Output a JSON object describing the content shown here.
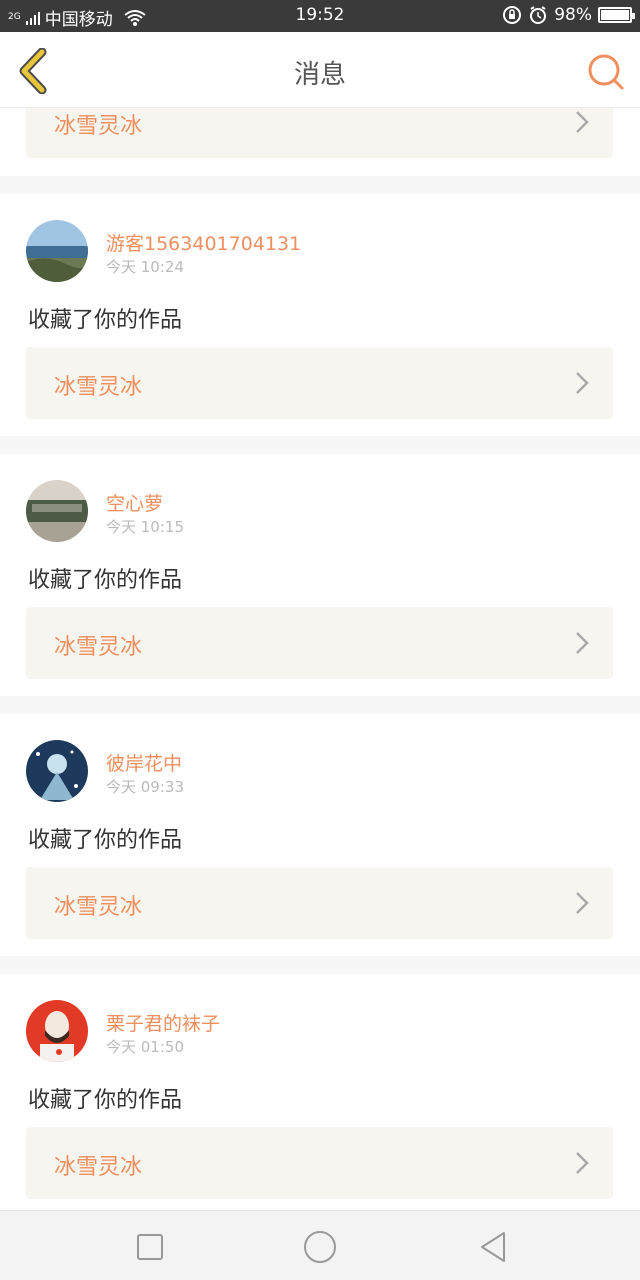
{
  "status_bar": {
    "network": "2G",
    "carrier": "中国移动",
    "time": "19:52",
    "battery": "98%",
    "icons": [
      "signal-icon",
      "wifi-icon",
      "rotation-lock-icon",
      "alarm-icon",
      "battery-icon"
    ]
  },
  "header": {
    "title": "消息",
    "back_icon": "chevron-left-icon",
    "search_icon": "search-icon"
  },
  "partial_item": {
    "work_title": "冰雪灵冰"
  },
  "messages": [
    {
      "username": "游客1563401704131",
      "time": "今天 10:24",
      "action": "收藏了你的作品",
      "work_title": "冰雪灵冰"
    },
    {
      "username": "空心萝",
      "time": "今天 10:15",
      "action": "收藏了你的作品",
      "work_title": "冰雪灵冰"
    },
    {
      "username": "彼岸花中",
      "time": "今天 09:33",
      "action": "收藏了你的作品",
      "work_title": "冰雪灵冰"
    },
    {
      "username": "栗子君的袜子",
      "time": "今天 01:50",
      "action": "收藏了你的作品",
      "work_title": "冰雪灵冰"
    }
  ],
  "colors": {
    "accent": "#ef8f5e",
    "back_icon": "#e8c63a",
    "work_box_bg": "#f6f5ef"
  },
  "nav_bar": {
    "icons": [
      "square-icon",
      "circle-icon",
      "triangle-back-icon"
    ]
  }
}
